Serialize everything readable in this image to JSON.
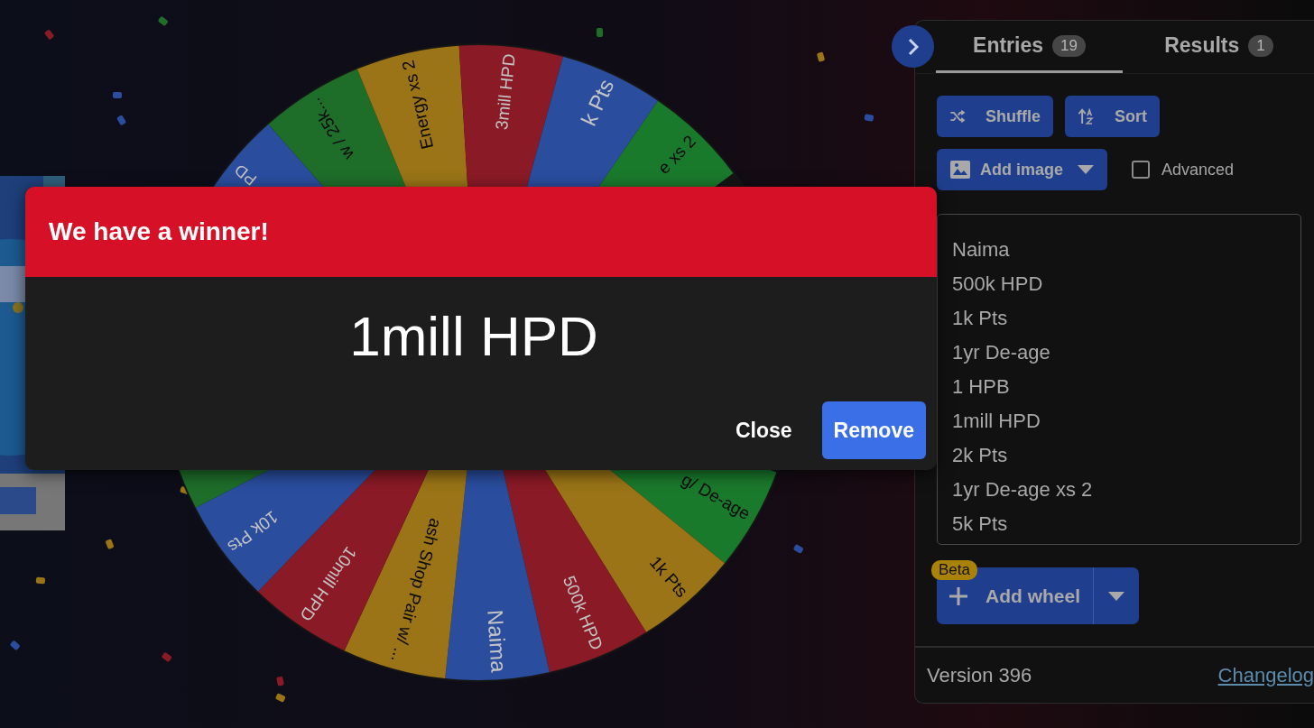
{
  "wheel": {
    "top_segments": [
      {
        "color": "#2a4d9e",
        "label": "PD"
      },
      {
        "color": "#1e6e2a",
        "label": "w / 25k..."
      },
      {
        "color": "#9a7416",
        "label": "Energy xs 2"
      },
      {
        "color": "#8a1a26",
        "label": "3mill HPD"
      },
      {
        "color": "#2a4d9e",
        "label": "k Pts"
      },
      {
        "color": "#1a7a2c",
        "label": "e xs 2"
      }
    ],
    "bottom_segments": [
      {
        "color": "#1a7a2c",
        "label": "g/ De-age"
      },
      {
        "color": "#9a7416",
        "label": "1k Pts"
      },
      {
        "color": "#8a1a26",
        "label": "500k HPD"
      },
      {
        "color": "#2a4d9e",
        "label": "Naima"
      },
      {
        "color": "#9a7416",
        "label": "ash Shop Pair w/ ..."
      },
      {
        "color": "#8a1a26",
        "label": "10mill HPD"
      },
      {
        "color": "#2a4d9e",
        "label": "10k Pts"
      },
      {
        "color": "#1e6e2a"
      }
    ]
  },
  "dialog": {
    "title": "We have a winner!",
    "winner": "1mill HPD",
    "buttons": [
      {
        "label": "Close",
        "kind": "text"
      },
      {
        "label": "Remove",
        "kind": "primary"
      }
    ]
  },
  "panel": {
    "tabs": [
      {
        "label": "Entries",
        "count": "19",
        "selected": true
      },
      {
        "label": "Results",
        "count": "1",
        "selected": false
      }
    ],
    "shuffle": "Shuffle",
    "sort": "Sort",
    "add_image": "Add image",
    "advanced": {
      "label": "Advanced",
      "checked": false
    },
    "entries": [
      "Naima",
      "500k HPD",
      "1k Pts",
      "1yr De-age",
      "1 HPB",
      "1mill HPD",
      "2k Pts",
      "1yr De-age xs 2",
      "5k Pts"
    ],
    "add_wheel": {
      "label": "Add wheel",
      "badge": "Beta"
    },
    "version": "Version 396",
    "changelog": "Changelog"
  }
}
